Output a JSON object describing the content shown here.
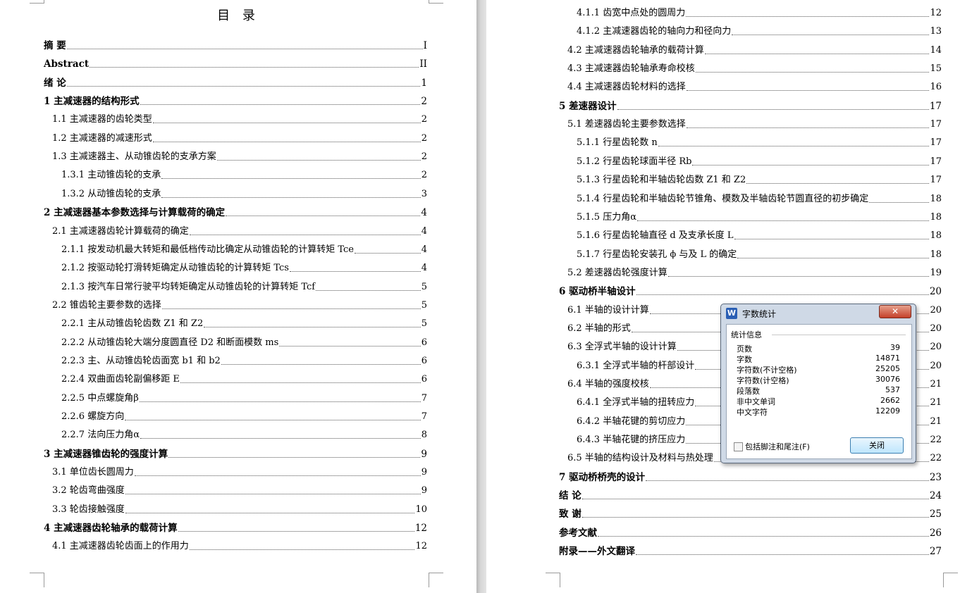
{
  "toc_title": "目 录",
  "left_entries": [
    {
      "level": 1,
      "text": "摘 要",
      "page": "I"
    },
    {
      "level": 1,
      "text": "Abstract",
      "page": "II"
    },
    {
      "level": 1,
      "text": "绪 论",
      "page": "1"
    },
    {
      "level": 1,
      "text": "1  主减速器的结构形式",
      "page": "2"
    },
    {
      "level": 2,
      "text": "1.1  主减速器的齿轮类型",
      "page": "2"
    },
    {
      "level": 2,
      "text": "1.2  主减速器的减速形式",
      "page": "2"
    },
    {
      "level": 2,
      "text": "1.3  主减速器主、从动锥齿轮的支承方案",
      "page": "2"
    },
    {
      "level": 3,
      "text": "1.3.1  主动锥齿轮的支承",
      "page": "2"
    },
    {
      "level": 3,
      "text": "1.3.2   从动锥齿轮的支承",
      "page": "3"
    },
    {
      "level": 1,
      "text": "2  主减速器基本参数选择与计算载荷的确定",
      "page": "4"
    },
    {
      "level": 2,
      "text": "2.1  主减速器齿轮计算载荷的确定",
      "page": "4"
    },
    {
      "level": 3,
      "text": "2.1.1 按发动机最大转矩和最低档传动比确定从动锥齿轮的计算转矩 Tce",
      "page": "4"
    },
    {
      "level": 3,
      "text": "2.1.2 按驱动轮打滑转矩确定从动锥齿轮的计算转矩 Tcs",
      "page": "4"
    },
    {
      "level": 3,
      "text": "2.1.3 按汽车日常行驶平均转矩确定从动锥齿轮的计算转矩 Tcf",
      "page": "5"
    },
    {
      "level": 2,
      "text": "2.2  锥齿轮主要参数的选择",
      "page": "5"
    },
    {
      "level": 3,
      "text": "2.2.1 主从动锥齿轮齿数 Z1 和 Z2",
      "page": "5"
    },
    {
      "level": 3,
      "text": "2.2.2 从动锥齿轮大端分度圆直径 D2 和断面模数 ms",
      "page": "6"
    },
    {
      "level": 3,
      "text": "2.2.3 主、从动锥齿轮齿面宽 b1 和 b2",
      "page": "6"
    },
    {
      "level": 3,
      "text": "2.2.4 双曲面齿轮副偏移距 E",
      "page": "6"
    },
    {
      "level": 3,
      "text": "2.2.5 中点螺旋角β",
      "page": "7"
    },
    {
      "level": 3,
      "text": "2.2.6 螺旋方向",
      "page": "7"
    },
    {
      "level": 3,
      "text": "2.2.7 法向压力角α",
      "page": "8"
    },
    {
      "level": 1,
      "text": "3  主减速器锥齿轮的强度计算",
      "page": "9"
    },
    {
      "level": 2,
      "text": "3.1  单位齿长圆周力",
      "page": "9"
    },
    {
      "level": 2,
      "text": "3.2  轮齿弯曲强度",
      "page": "9"
    },
    {
      "level": 2,
      "text": "3.3  轮齿接触强度",
      "page": "10"
    },
    {
      "level": 1,
      "text": "4  主减速器齿轮轴承的载荷计算",
      "page": "12"
    },
    {
      "level": 2,
      "text": "4.1  主减速器齿轮齿面上的作用力",
      "page": "12"
    }
  ],
  "right_entries": [
    {
      "level": 3,
      "text": "4.1.1  齿宽中点处的圆周力",
      "page": "12"
    },
    {
      "level": 3,
      "text": "4.1.2  主减速器齿轮的轴向力和径向力",
      "page": "13"
    },
    {
      "level": 2,
      "text": "4.2  主减速器齿轮轴承的载荷计算",
      "page": "14"
    },
    {
      "level": 2,
      "text": "4.3  主减速器齿轮轴承寿命校核",
      "page": "15"
    },
    {
      "level": 2,
      "text": "4.4  主减速器齿轮材料的选择",
      "page": "16"
    },
    {
      "level": 1,
      "text": "5  差速器设计",
      "page": "17"
    },
    {
      "level": 2,
      "text": "5.1  差速器齿轮主要参数选择",
      "page": "17"
    },
    {
      "level": 3,
      "text": "5.1.1  行星齿轮数 n",
      "page": "17"
    },
    {
      "level": 3,
      "text": "5.1.2  行星齿轮球面半径 Rb",
      "page": "17"
    },
    {
      "level": 3,
      "text": "5.1.3  行星齿轮和半轴齿轮齿数 Z1 和 Z2",
      "page": "17"
    },
    {
      "level": 3,
      "text": "5.1.4  行星齿轮和半轴齿轮节锥角、模数及半轴齿轮节圆直径的初步确定",
      "page": "18"
    },
    {
      "level": 3,
      "text": "5.1.5  压力角α",
      "page": "18"
    },
    {
      "level": 3,
      "text": "5.1.6  行星齿轮轴直径 d 及支承长度 L",
      "page": "18"
    },
    {
      "level": 3,
      "text": "5.1.7  行星齿轮安装孔 ϕ 与及 L 的确定",
      "page": "18"
    },
    {
      "level": 2,
      "text": "5.2  差速器齿轮强度计算",
      "page": "19"
    },
    {
      "level": 1,
      "text": "6  驱动桥半轴设计",
      "page": "20"
    },
    {
      "level": 2,
      "text": "6.1  半轴的设计计算",
      "page": "20"
    },
    {
      "level": 2,
      "text": "6.2  半轴的形式",
      "page": "20"
    },
    {
      "level": 2,
      "text": "6.3  全浮式半轴的设计计算",
      "page": "20"
    },
    {
      "level": 3,
      "text": "6.3.1  全浮式半轴的杆部设计",
      "page": "20"
    },
    {
      "level": 2,
      "text": "6.4  半轴的强度校核",
      "page": "21"
    },
    {
      "level": 3,
      "text": "6.4.1  全浮式半轴的扭转应力",
      "page": "21"
    },
    {
      "level": 3,
      "text": "6.4.2  半轴花键的剪切应力",
      "page": "21"
    },
    {
      "level": 3,
      "text": "6.4.3  半轴花键的挤压应力",
      "page": "22"
    },
    {
      "level": 2,
      "text": "6.5  半轴的结构设计及材料与热处理",
      "page": "22"
    },
    {
      "level": 1,
      "text": "7  驱动桥桥壳的设计",
      "page": "23"
    },
    {
      "level": 1,
      "text": "结 论",
      "page": "24"
    },
    {
      "level": 1,
      "text": "致 谢",
      "page": "25"
    },
    {
      "level": 1,
      "text": "参考文献",
      "page": "26"
    },
    {
      "level": 1,
      "text": "附录——外文翻译",
      "page": "27"
    }
  ],
  "dialog": {
    "icon_letter": "W",
    "title": "字数统计",
    "close_x": "✕",
    "group_label": "统计信息",
    "stats": [
      {
        "label": "页数",
        "value": "39"
      },
      {
        "label": "字数",
        "value": "14871"
      },
      {
        "label": "字符数(不计空格)",
        "value": "25205"
      },
      {
        "label": "字符数(计空格)",
        "value": "30076"
      },
      {
        "label": "段落数",
        "value": "537"
      },
      {
        "label": "非中文单词",
        "value": "2662"
      },
      {
        "label": "中文字符",
        "value": "12209"
      }
    ],
    "checkbox_label": "包括脚注和尾注(F)",
    "close_button": "关闭"
  },
  "colors": {
    "dialog_bg": "#cfd9e6",
    "close_red": "#c4402a",
    "button_blue": "#bee6fd"
  }
}
